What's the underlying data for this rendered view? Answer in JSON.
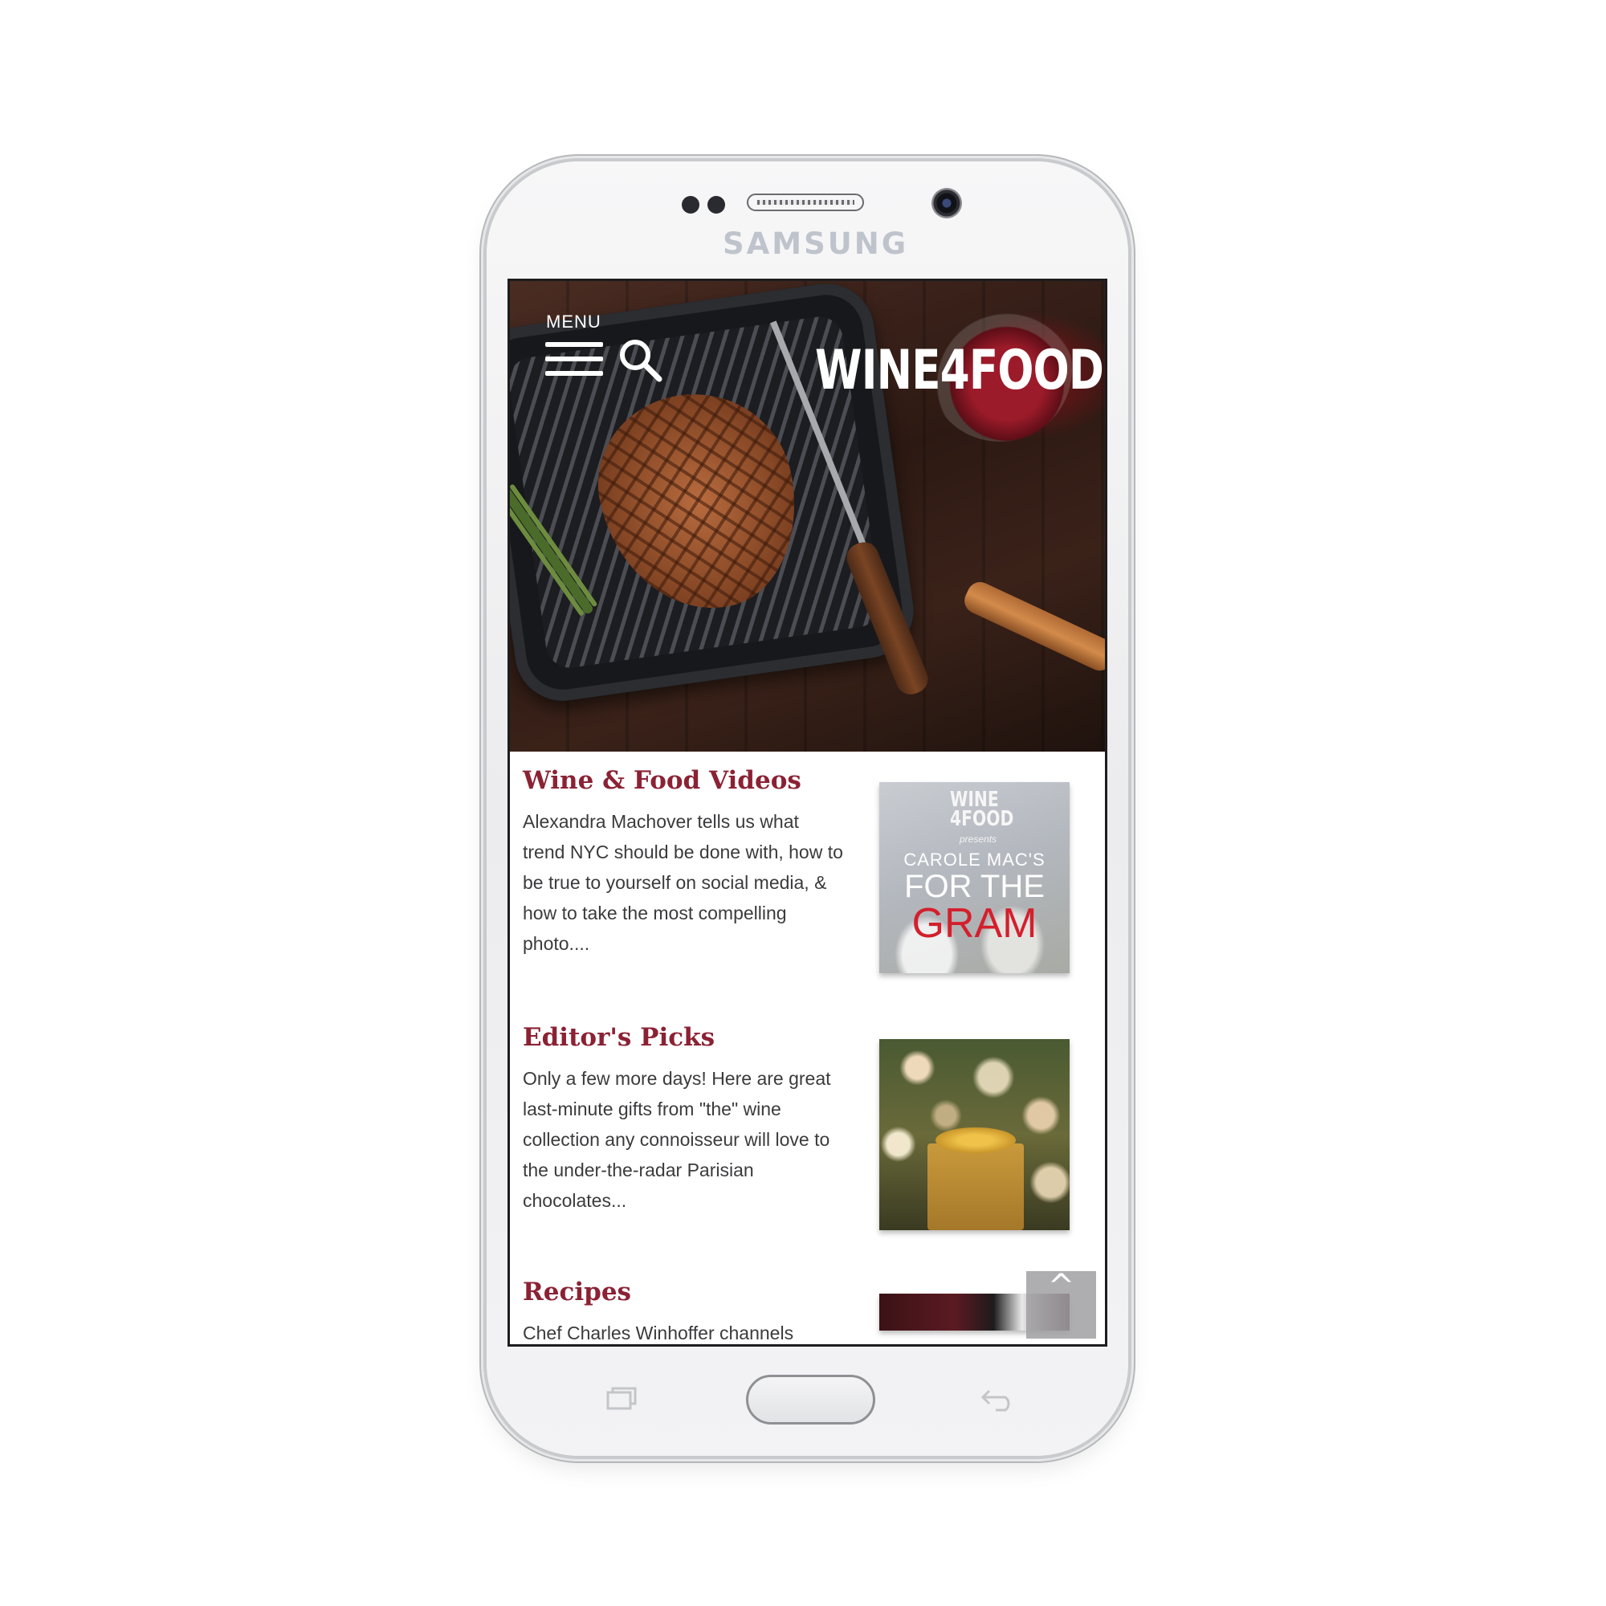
{
  "device": {
    "brand": "SAMSUNG"
  },
  "header": {
    "menu_label": "MENU",
    "logo": "WINE4FOOD"
  },
  "articles": [
    {
      "title": "Wine & Food Videos",
      "excerpt": "Alexandra Machover tells us what trend NYC should be done with, how to be true to yourself on social media, & how to take the most compelling photo....",
      "thumbnail": {
        "brand": "WINE 4FOOD",
        "presents": "presents",
        "line1": "CAROLE MAC'S",
        "line2": "FOR THE",
        "line3": "GRAM"
      }
    },
    {
      "title": "Editor's Picks",
      "excerpt": "Only a few more days! Here are great last-minute gifts from \"the\" wine collection any connoisseur will love to the under-the-radar Parisian chocolates..."
    },
    {
      "title": "Recipes",
      "excerpt": "Chef Charles Winhoffer channels"
    }
  ],
  "back_to_top": {
    "icon": "caret-up",
    "label": "^"
  },
  "icons": {
    "menu": "hamburger-icon",
    "search": "search-icon",
    "recent": "recent-apps-icon",
    "back": "back-icon"
  },
  "colors": {
    "title_accent": "#8b2234",
    "body_text": "#3b3b3d"
  }
}
